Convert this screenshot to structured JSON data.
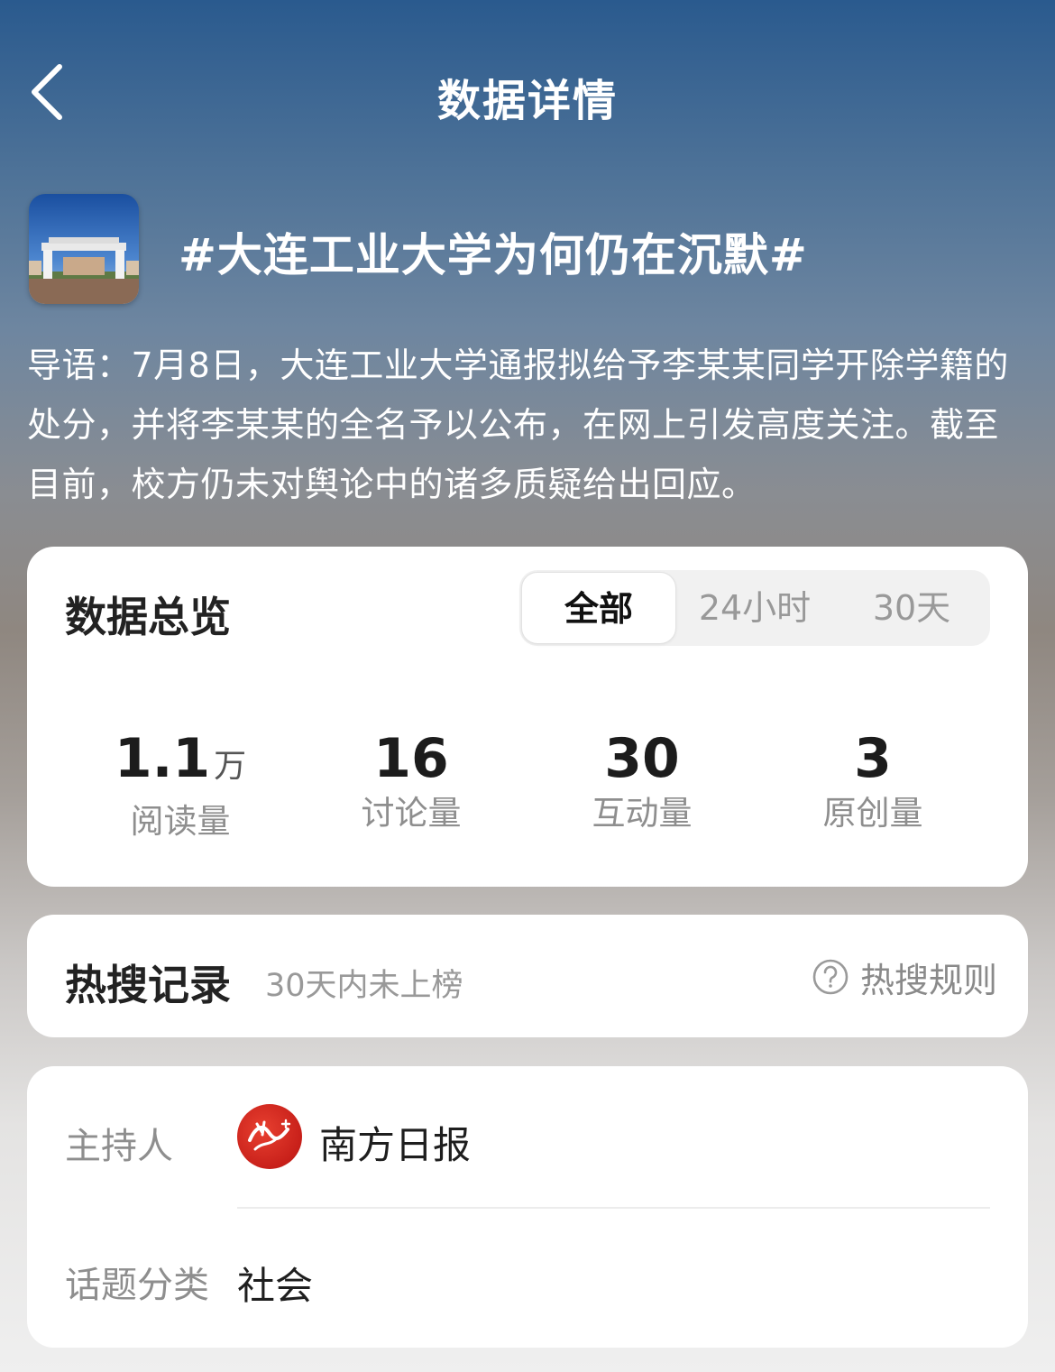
{
  "header": {
    "title": "数据详情"
  },
  "topic": {
    "name": "#大连工业大学为何仍在沉默#",
    "intro": "导语：7月8日，大连工业大学通报拟给予李某某同学开除学籍的处分，并将李某某的全名予以公布，在网上引发高度关注。截至目前，校方仍未对舆论中的诸多质疑给出回应。"
  },
  "overview": {
    "title": "数据总览",
    "tabs": [
      {
        "label": "全部",
        "active": true
      },
      {
        "label": "24小时",
        "active": false
      },
      {
        "label": "30天",
        "active": false
      }
    ],
    "stats": [
      {
        "value": "1.1",
        "unit": "万",
        "label": "阅读量"
      },
      {
        "value": "16",
        "unit": "",
        "label": "讨论量"
      },
      {
        "value": "30",
        "unit": "",
        "label": "互动量"
      },
      {
        "value": "3",
        "unit": "",
        "label": "原创量"
      }
    ]
  },
  "hot_search": {
    "title": "热搜记录",
    "status": "30天内未上榜",
    "rules_label": "热搜规则"
  },
  "info": {
    "host_label": "主持人",
    "host_name": "南方日报",
    "category_label": "话题分类",
    "category_value": "社会"
  },
  "icons": {
    "back": "chevron-left-icon",
    "help": "question-circle-icon"
  },
  "colors": {
    "card_bg": "#ffffff",
    "host_logo_red": "#d42a1f"
  }
}
